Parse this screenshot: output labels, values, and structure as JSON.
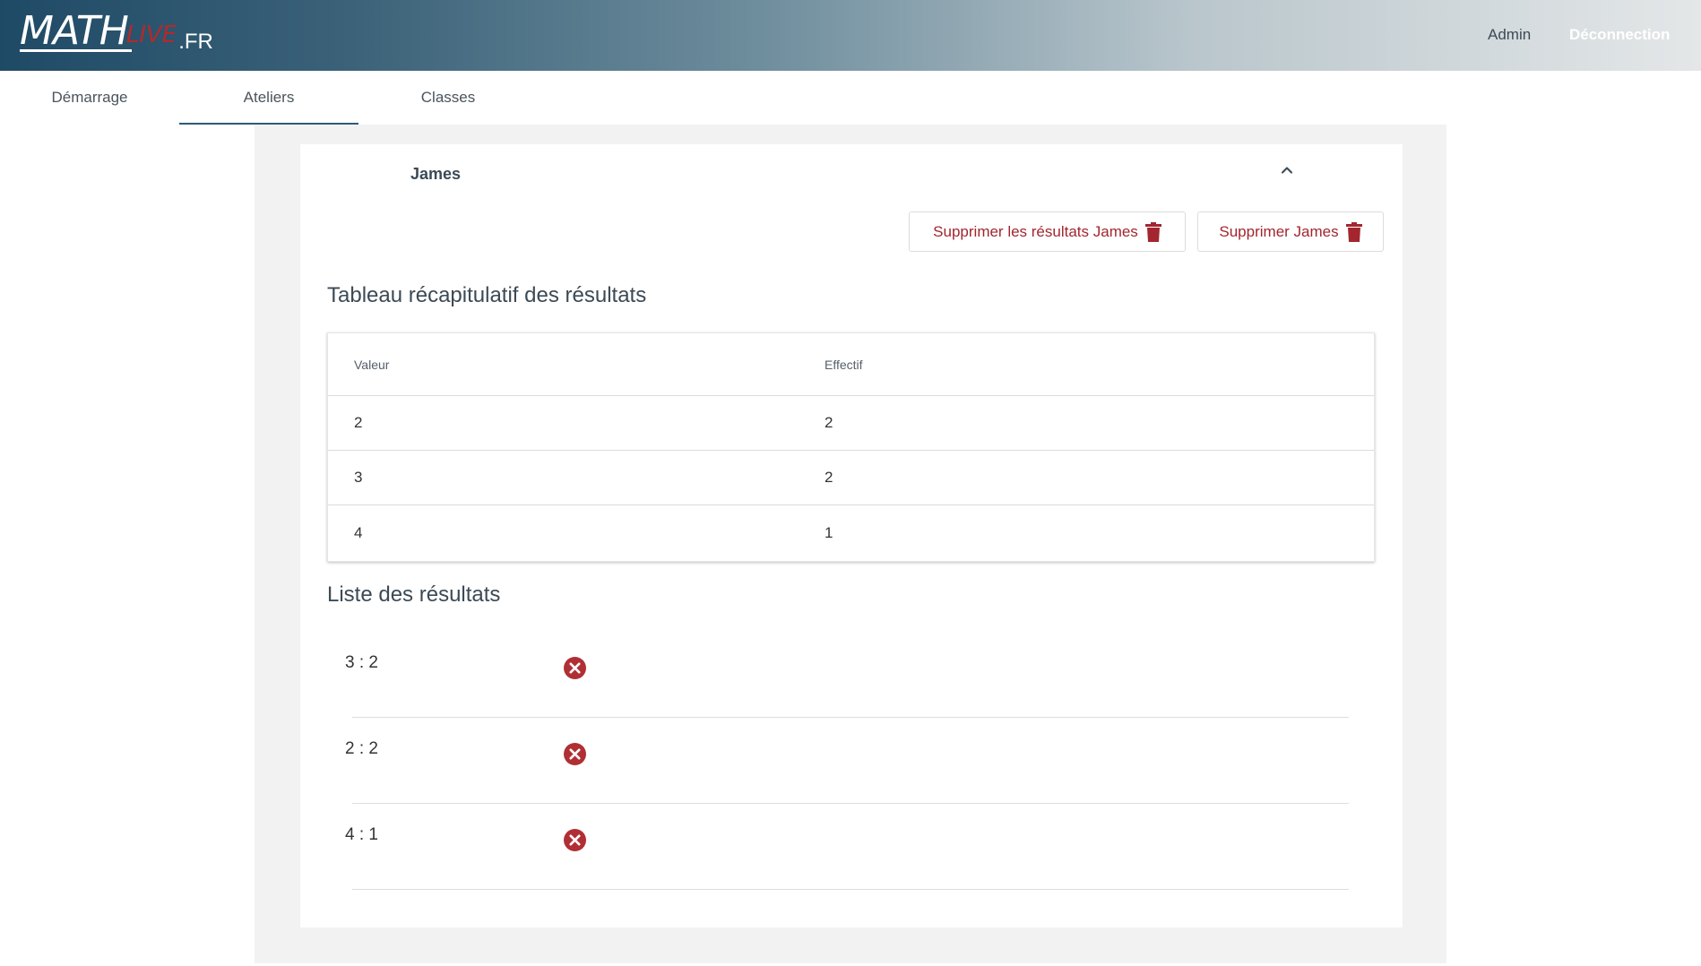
{
  "header": {
    "logo": {
      "main": "MATH",
      "accent": "LIVE",
      "suffix": ".FR"
    },
    "admin_label": "Admin",
    "logout_label": "Déconnection",
    "colors": {
      "accent": "#a3262e",
      "brand": "#1f4a66"
    }
  },
  "tabs": [
    {
      "label": "Démarrage",
      "active": false
    },
    {
      "label": "Ateliers",
      "active": true
    },
    {
      "label": "Classes",
      "active": false
    }
  ],
  "student": {
    "name": "James",
    "collapse_icon": "chevron-up-icon",
    "delete_results_label": "Supprimer les résultats James",
    "delete_student_label": "Supprimer James",
    "delete_icon": "trash-icon"
  },
  "summary": {
    "title": "Tableau récapitulatif des résultats",
    "columns": [
      "Valeur",
      "Effectif"
    ],
    "rows": [
      [
        "2",
        "2"
      ],
      [
        "3",
        "2"
      ],
      [
        "4",
        "1"
      ]
    ]
  },
  "results": {
    "title": "Liste des résultats",
    "remove_icon": "close-circle-icon",
    "items": [
      "3 : 2",
      "2 : 2",
      "4 : 1"
    ]
  }
}
